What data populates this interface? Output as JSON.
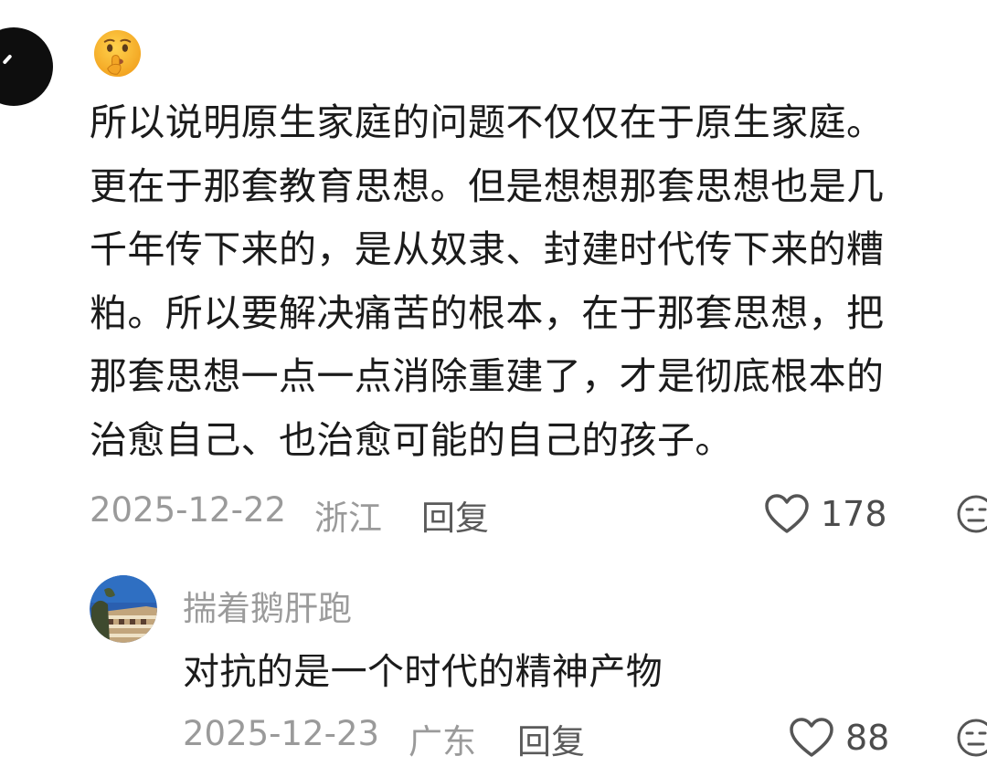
{
  "main_comment": {
    "emoji": "shushing-face-icon",
    "text": "所以说明原生家庭的问题不仅仅在于原生家庭。\n更在于那套教育思想。但是想想那套思想也是几\n千年传下来的，是从奴隶、封建时代传下来的糟\n粕。所以要解决痛苦的根本，在于那套思想，把\n那套思想一点一点消除重建了，才是彻底根本的\n治愈自己、也治愈可能的自己的孩子。",
    "date": "2025-12-22",
    "location": "浙江",
    "reply_label": "回复",
    "likes": "178"
  },
  "reply_comment": {
    "username": "揣着鹅肝跑",
    "text": "对抗的是一个时代的精神产物",
    "date": "2025-12-23",
    "location": "广东",
    "reply_label": "回复",
    "likes": "88"
  },
  "colors": {
    "text_primary": "#1b1b1b",
    "text_meta": "#9a9a9a",
    "reply_label": "#5a5a5a",
    "emoji_yellow": "#f7b52c"
  }
}
